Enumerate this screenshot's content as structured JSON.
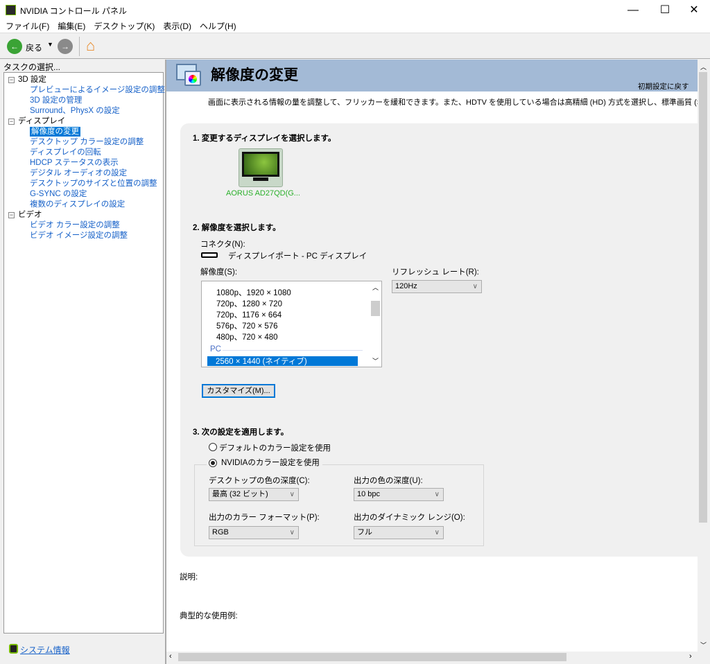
{
  "window": {
    "title": "NVIDIA コントロール パネル",
    "minimize": "—",
    "maximize": "☐",
    "close": "✕"
  },
  "menu": [
    "ファイル(F)",
    "編集(E)",
    "デスクトップ(K)",
    "表示(D)",
    "ヘルプ(H)"
  ],
  "toolbar": {
    "back_label": "戻る"
  },
  "sidebar": {
    "title": "タスクの選択...",
    "categories": [
      {
        "label": "3D 設定",
        "items": [
          "プレビューによるイメージ設定の調整",
          "3D 設定の管理",
          "Surround、PhysX の設定"
        ]
      },
      {
        "label": "ディスプレイ",
        "items": [
          "解像度の変更",
          "デスクトップ カラー設定の調整",
          "ディスプレイの回転",
          "HDCP ステータスの表示",
          "デジタル オーディオの設定",
          "デスクトップのサイズと位置の調整",
          "G-SYNC の設定",
          "複数のディスプレイの設定"
        ]
      },
      {
        "label": "ビデオ",
        "items": [
          "ビデオ カラー設定の調整",
          "ビデオ イメージ設定の調整"
        ]
      }
    ],
    "system_info": "システム情報"
  },
  "page": {
    "title": "解像度の変更",
    "restore_defaults": "初期設定に戻す",
    "description": "画面に表示される情報の量を調整して、フリッカーを緩和できます。また、HDTV を使用している場合は高精細 (HD) 方式を選択し、標準画質 (SD) TV の場合は",
    "step1": "1. 変更するディスプレイを選択します。",
    "display_name": "AORUS AD27QD(G...",
    "step2": "2. 解像度を選択します。",
    "connector_label": "コネクタ(N):",
    "connector_value": "ディスプレイポート - PC ディスプレイ",
    "resolution_label": "解像度(S):",
    "resolutions": [
      "1080p、1920 × 1080",
      "720p、1280 × 720",
      "720p、1176 × 664",
      "576p、720 × 576",
      "480p、720 × 480"
    ],
    "pc_group": "PC",
    "selected_resolution": "2560 × 1440 (ネイティブ)",
    "refresh_label": "リフレッシュ レート(R):",
    "refresh_value": "120Hz",
    "customize": "カスタマイズ(M)...",
    "step3": "3. 次の設定を適用します。",
    "radio_default": "デフォルトのカラー設定を使用",
    "radio_nvidia": "NVIDIAのカラー設定を使用",
    "desktop_depth_label": "デスクトップの色の深度(C):",
    "desktop_depth": "最高 (32 ビット)",
    "output_depth_label": "出力の色の深度(U):",
    "output_depth": "10 bpc",
    "color_format_label": "出力のカラー フォーマット(P):",
    "color_format": "RGB",
    "dynamic_range_label": "出力のダイナミック レンジ(O):",
    "dynamic_range": "フル",
    "explanation": "説明:",
    "typical_usage": "典型的な使用例:"
  }
}
